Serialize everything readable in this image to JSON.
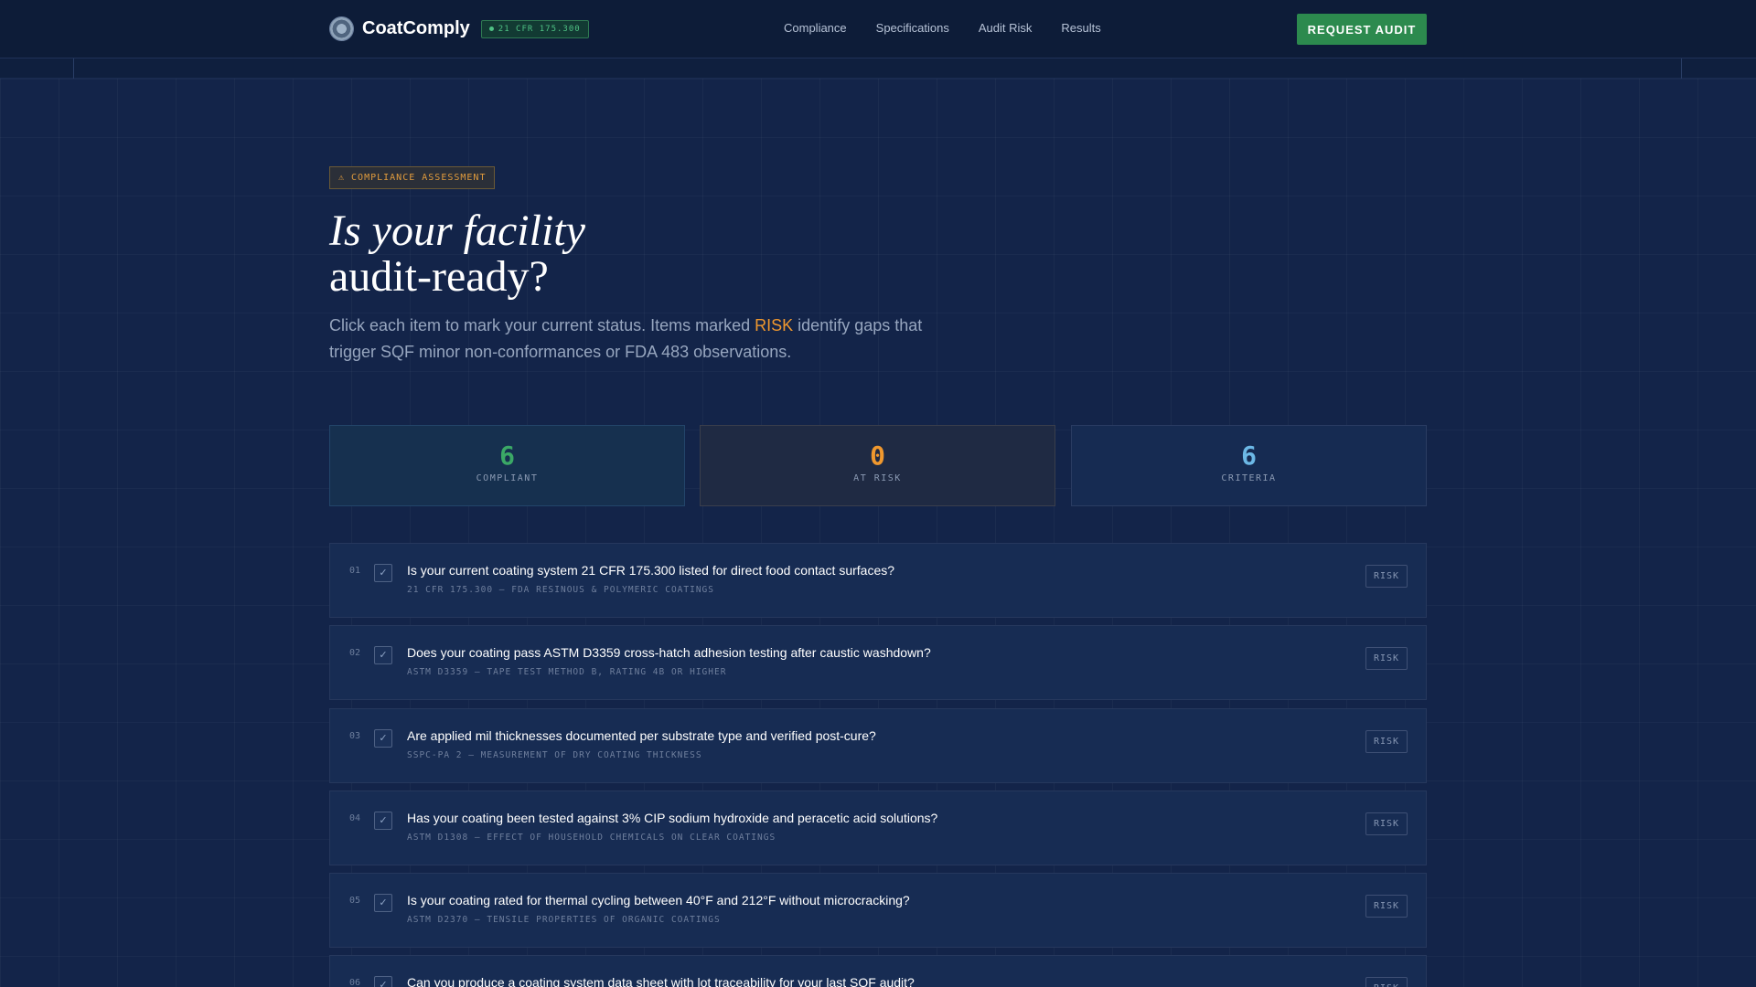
{
  "header": {
    "brand": "CoatComply",
    "badge": "21 CFR 175.300",
    "nav": [
      "Compliance",
      "Specifications",
      "Audit Risk",
      "Results"
    ],
    "cta": "REQUEST AUDIT"
  },
  "hero": {
    "eyebrow": "⚠ COMPLIANCE ASSESSMENT",
    "title_line1": "Is your facility",
    "title_line2": "audit-ready?",
    "desc_before": "Click each item to mark your current status. Items marked ",
    "desc_highlight": "RISK",
    "desc_after": " identify gaps that trigger SQF minor non-conformances or FDA 483 observations."
  },
  "stats": {
    "compliant": {
      "value": "6",
      "label": "COMPLIANT"
    },
    "at_risk": {
      "value": "0",
      "label": "AT RISK"
    },
    "criteria": {
      "value": "6",
      "label": "CRITERIA"
    }
  },
  "checklist": [
    {
      "index": "01",
      "check": "✓",
      "question": "Is your current coating system 21 CFR 175.300 listed for direct food contact surfaces?",
      "reference": "21 CFR 175.300 — FDA RESINOUS & POLYMERIC COATINGS",
      "risk_label": "RISK"
    },
    {
      "index": "02",
      "check": "✓",
      "question": "Does your coating pass ASTM D3359 cross-hatch adhesion testing after caustic washdown?",
      "reference": "ASTM D3359 — TAPE TEST METHOD B, RATING 4B OR HIGHER",
      "risk_label": "RISK"
    },
    {
      "index": "03",
      "check": "✓",
      "question": "Are applied mil thicknesses documented per substrate type and verified post-cure?",
      "reference": "SSPC-PA 2 — MEASUREMENT OF DRY COATING THICKNESS",
      "risk_label": "RISK"
    },
    {
      "index": "04",
      "check": "✓",
      "question": "Has your coating been tested against 3% CIP sodium hydroxide and peracetic acid solutions?",
      "reference": "ASTM D1308 — EFFECT OF HOUSEHOLD CHEMICALS ON CLEAR COATINGS",
      "risk_label": "RISK"
    },
    {
      "index": "05",
      "check": "✓",
      "question": "Is your coating rated for thermal cycling between 40°F and 212°F without microcracking?",
      "reference": "ASTM D2370 — TENSILE PROPERTIES OF ORGANIC COATINGS",
      "risk_label": "RISK"
    },
    {
      "index": "06",
      "check": "✓",
      "question": "Can you produce a coating system data sheet with lot traceability for your last SQF audit?",
      "reference": "",
      "risk_label": "RISK"
    }
  ]
}
